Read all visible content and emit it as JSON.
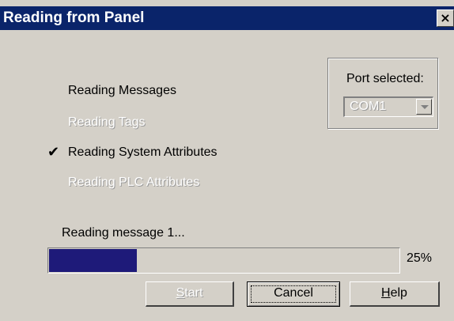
{
  "window": {
    "title": "Reading from Panel",
    "close_glyph": "×"
  },
  "steps": [
    {
      "label": "Reading Messages",
      "state": "active"
    },
    {
      "label": "Reading Tags",
      "state": "pending"
    },
    {
      "label": "Reading System Attributes",
      "state": "done"
    },
    {
      "label": "Reading PLC Attributes",
      "state": "pending"
    }
  ],
  "check_glyph": "✔",
  "port": {
    "label": "Port selected:",
    "value": "COM1"
  },
  "status": {
    "message": "Reading message 1...",
    "progress_fraction": 0.25,
    "percent_label": "25%"
  },
  "buttons": {
    "start": {
      "label_first": "S",
      "label_rest": "tart",
      "enabled": false
    },
    "cancel": {
      "label": "Cancel",
      "enabled": true
    },
    "help": {
      "label_first": "H",
      "label_rest": "elp",
      "enabled": true
    }
  },
  "colors": {
    "titlebar": "#0a246a",
    "progress_fill": "#1e1a79",
    "face": "#d4d0c8"
  }
}
